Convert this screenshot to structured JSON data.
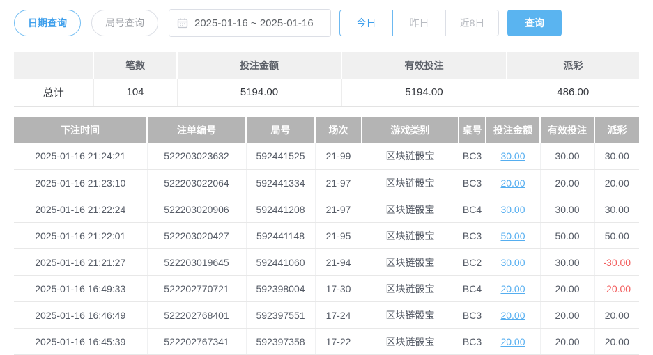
{
  "toolbar": {
    "date_query_label": "日期查询",
    "round_query_label": "局号查询",
    "date_picker": {
      "icon": "calendar-icon",
      "value": "2025-01-16 ~ 2025-01-16"
    },
    "today_label": "今日",
    "yesterday_label": "昨日",
    "last8_label": "近8日",
    "query_label": "查询"
  },
  "summary": {
    "headers": [
      "",
      "笔数",
      "投注金额",
      "有效投注",
      "派彩"
    ],
    "row_label": "总计",
    "values": [
      "104",
      "5194.00",
      "5194.00",
      "486.00"
    ]
  },
  "table": {
    "headers": [
      "下注时间",
      "注单编号",
      "局号",
      "场次",
      "游戏类别",
      "桌号",
      "投注金额",
      "有效投注",
      "派彩"
    ],
    "rows": [
      [
        "2025-01-16 21:24:21",
        "522203023632",
        "592441525",
        "21-99",
        "区块链骰宝",
        "BC3",
        "30.00",
        "30.00",
        "30.00"
      ],
      [
        "2025-01-16 21:23:10",
        "522203022064",
        "592441334",
        "21-97",
        "区块链骰宝",
        "BC3",
        "20.00",
        "20.00",
        "20.00"
      ],
      [
        "2025-01-16 21:22:24",
        "522203020906",
        "592441208",
        "21-97",
        "区块链骰宝",
        "BC4",
        "30.00",
        "30.00",
        "30.00"
      ],
      [
        "2025-01-16 21:22:01",
        "522203020427",
        "592441148",
        "21-95",
        "区块链骰宝",
        "BC3",
        "50.00",
        "50.00",
        "50.00"
      ],
      [
        "2025-01-16 21:21:27",
        "522203019645",
        "592441060",
        "21-94",
        "区块链骰宝",
        "BC2",
        "30.00",
        "30.00",
        "-30.00"
      ],
      [
        "2025-01-16 16:49:33",
        "522202770721",
        "592398004",
        "17-30",
        "区块链骰宝",
        "BC4",
        "20.00",
        "20.00",
        "-20.00"
      ],
      [
        "2025-01-16 16:46:49",
        "522202768401",
        "592397551",
        "17-24",
        "区块链骰宝",
        "BC3",
        "20.00",
        "20.00",
        "20.00"
      ],
      [
        "2025-01-16 16:45:39",
        "522202767341",
        "592397358",
        "17-22",
        "区块链骰宝",
        "BC3",
        "20.00",
        "20.00",
        "20.00"
      ]
    ]
  },
  "colors": {
    "accent_blue": "#3e9fec",
    "link_blue": "#55aef0",
    "query_button_blue": "#5ab4f0",
    "negative_red": "#f25c5c",
    "table_header_gray": "#b4b4b4",
    "summary_header_gray": "#f0f0f0"
  }
}
